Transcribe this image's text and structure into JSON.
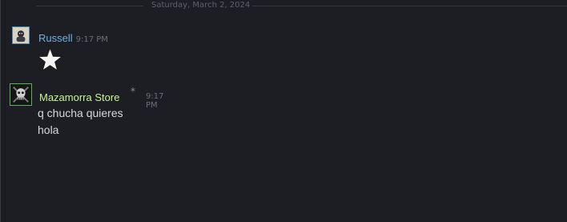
{
  "date_divider": {
    "text": "Saturday, March 2, 2024"
  },
  "messages": [
    {
      "author": "Russell",
      "time": "9:17 PM",
      "content_type": "emoticon",
      "emoticon_icon": "star-icon",
      "author_color": "#6fb1dc"
    },
    {
      "author": "Mazamorra Store",
      "badge": "*",
      "time": "9:17 PM",
      "author_color": "#c7f58f",
      "lines": [
        "q chucha quieres",
        "hola"
      ]
    }
  ],
  "colors": {
    "background": "#1d1e23",
    "divider": "#35363b",
    "text": "#d7d8da",
    "timestamp": "#6b6e75"
  }
}
